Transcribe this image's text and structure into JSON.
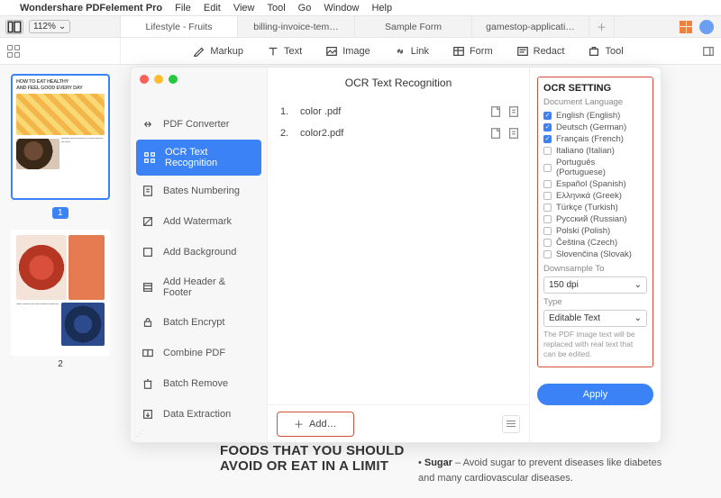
{
  "mac_menu": {
    "app": "Wondershare PDFelement Pro",
    "items": [
      "File",
      "Edit",
      "View",
      "Tool",
      "Go",
      "Window",
      "Help"
    ]
  },
  "doc_bar": {
    "zoom": "112%",
    "tabs": [
      "Lifestyle - Fruits",
      "billing-invoice-tem…",
      "Sample Form",
      "gamestop-applicati…"
    ]
  },
  "ribbon": {
    "tools": [
      "Markup",
      "Text",
      "Image",
      "Link",
      "Form",
      "Redact",
      "Tool"
    ]
  },
  "thumbs": {
    "page1": "1",
    "page2": "2",
    "thumb1_line1": "HOW TO EAT HEALTHY",
    "thumb1_line2": "AND FEEL GOOD EVERY DAY"
  },
  "doc_content": {
    "heading_l1": "FOODS THAT YOU SHOULD",
    "heading_l2": "AVOID OR EAT IN A LIMIT",
    "bullet_bold": "Sugar",
    "bullet_rest": " – Avoid sugar to prevent diseases like diabetes and many cardiovascular diseases."
  },
  "dialog": {
    "title": "OCR Text Recognition",
    "side_items": [
      "PDF Converter",
      "OCR Text Recognition",
      "Bates Numbering",
      "Add Watermark",
      "Add Background",
      "Add Header & Footer",
      "Batch Encrypt",
      "Combine PDF",
      "Batch Remove",
      "Data Extraction"
    ],
    "files": [
      {
        "num": "1.",
        "name": "color .pdf"
      },
      {
        "num": "2.",
        "name": "color2.pdf"
      }
    ],
    "add_label": "Add…"
  },
  "settings": {
    "heading": "OCR SETTING",
    "doc_lang_label": "Document Language",
    "languages": [
      {
        "label": "English (English)",
        "checked": true
      },
      {
        "label": "Deutsch (German)",
        "checked": true
      },
      {
        "label": "Français (French)",
        "checked": true
      },
      {
        "label": "Italiano (Italian)",
        "checked": false
      },
      {
        "label": "Português (Portuguese)",
        "checked": false
      },
      {
        "label": "Español (Spanish)",
        "checked": false
      },
      {
        "label": "Ελληνικά (Greek)",
        "checked": false
      },
      {
        "label": "Türkçe (Turkish)",
        "checked": false
      },
      {
        "label": "Русский (Russian)",
        "checked": false
      },
      {
        "label": "Polski (Polish)",
        "checked": false
      },
      {
        "label": "Čeština (Czech)",
        "checked": false
      },
      {
        "label": "Slovenčina (Slovak)",
        "checked": false
      }
    ],
    "downsample_label": "Downsample To",
    "downsample_value": "150 dpi",
    "type_label": "Type",
    "type_value": "Editable Text",
    "hint": "The PDF image text will be replaced with real text that can be edited.",
    "apply": "Apply"
  }
}
